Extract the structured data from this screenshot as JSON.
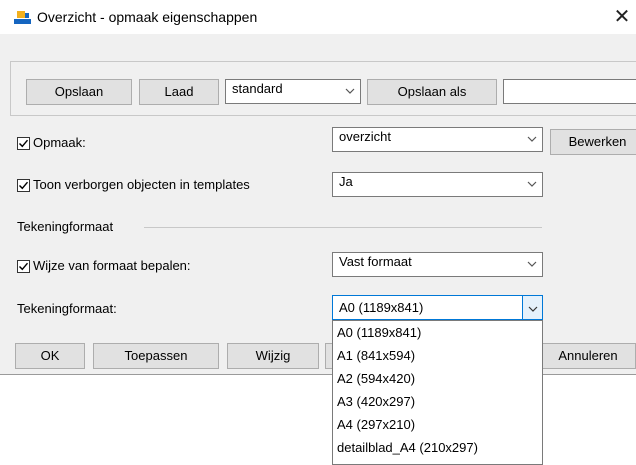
{
  "window": {
    "title": "Overzicht - opmaak eigenschappen",
    "close_glyph": "✕"
  },
  "toolbar": {
    "save_label": "Opslaan",
    "load_label": "Laad",
    "preset_value": "standard",
    "save_as_label": "Opslaan als",
    "save_as_name": ""
  },
  "opmaak": {
    "label": "Opmaak:",
    "checked": true,
    "value": "overzicht",
    "edit_label": "Bewerken"
  },
  "hidden_objects": {
    "label": "Toon verborgen objecten in templates",
    "checked": true,
    "value": "Ja"
  },
  "section": {
    "title": "Tekeningformaat"
  },
  "format_mode": {
    "label": "Wijze van formaat bepalen:",
    "checked": true,
    "value": "Vast formaat"
  },
  "drawing_format": {
    "label": "Tekeningformaat:",
    "value": "A0 (1189x841)",
    "options": [
      "A0 (1189x841)",
      "A1 (841x594)",
      "A2 (594x420)",
      "A3 (420x297)",
      "A4 (297x210)",
      "detailblad_A4 (210x297)"
    ]
  },
  "footer": {
    "ok_label": "OK",
    "apply_label": "Toepassen",
    "change_label": "Wijzig",
    "cancel_label": "Annuleren"
  }
}
